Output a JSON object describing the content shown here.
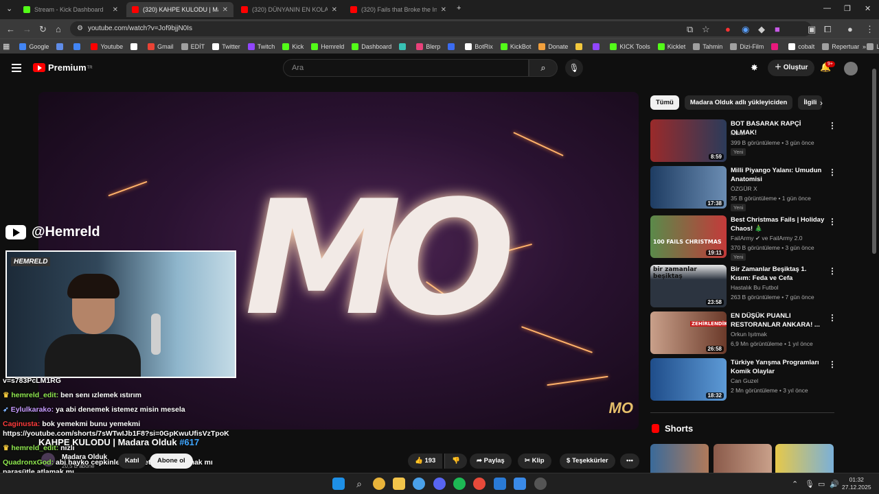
{
  "browser": {
    "tabs": [
      {
        "title": "Stream - Kick Dashboard",
        "color": "#53fc18"
      },
      {
        "title": "(320) KAHPE KULODU | Madara",
        "color": "#ff0000"
      },
      {
        "title": "(320) DÜNYANIN EN KOLAY BA",
        "color": "#ff0000"
      },
      {
        "title": "(320) Fails that Broke the Inter",
        "color": "#ff0000"
      }
    ],
    "url": "youtube.com/watch?v=Jof9bjjN0Is",
    "bookmarks": [
      {
        "label": "Google",
        "color": "#4285f4"
      },
      {
        "label": "",
        "color": "#5f8ce8"
      },
      {
        "label": "",
        "color": "#4285f4"
      },
      {
        "label": "Youtube",
        "color": "#ff0000"
      },
      {
        "label": "",
        "color": "#ffffff"
      },
      {
        "label": "Gmail",
        "color": "#ea4335"
      },
      {
        "label": "EDİT",
        "color": "#a0a0a0"
      },
      {
        "label": "Twitter",
        "color": "#ffffff"
      },
      {
        "label": "Twitch",
        "color": "#9146ff"
      },
      {
        "label": "Kick",
        "color": "#53fc18"
      },
      {
        "label": "Hemreld",
        "color": "#53fc18"
      },
      {
        "label": "Dashboard",
        "color": "#53fc18"
      },
      {
        "label": "",
        "color": "#38c2b5"
      },
      {
        "label": "Blerp",
        "color": "#e8417a"
      },
      {
        "label": "",
        "color": "#3b6cf2"
      },
      {
        "label": "BotRix",
        "color": "#ffffff"
      },
      {
        "label": "KickBot",
        "color": "#53fc18"
      },
      {
        "label": "Donate",
        "color": "#f2a03d"
      },
      {
        "label": "",
        "color": "#f2c83d"
      },
      {
        "label": "",
        "color": "#9146ff"
      },
      {
        "label": "KICK Tools",
        "color": "#53fc18"
      },
      {
        "label": "Kicklet",
        "color": "#53fc18"
      },
      {
        "label": "Tahmin",
        "color": "#a0a0a0"
      },
      {
        "label": "Dizi-Film",
        "color": "#a0a0a0"
      },
      {
        "label": "",
        "color": "#e8197c"
      },
      {
        "label": "cobalt",
        "color": "#ffffff"
      },
      {
        "label": "Repertuar",
        "color": "#a0a0a0"
      },
      {
        "label": "Looper",
        "color": "#a0a0a0"
      }
    ]
  },
  "youtube": {
    "logo_text": "Premium",
    "logo_sup": "TR",
    "search_placeholder": "Ara",
    "create_label": "Oluştur",
    "notif_count": "9+"
  },
  "video": {
    "title": "KAHPE KULODU | Madara Olduk",
    "hashtag": "#617",
    "channel": "Madara Olduk",
    "subs": "20,5 B abone",
    "join_label": "Katıl",
    "subscribe_label": "Abone ol",
    "likes": "193",
    "share_label": "Paylaş",
    "clip_label": "Klip",
    "thanks_label": "Teşekkürler",
    "watermark_small": "MO"
  },
  "overlay": {
    "handle": "@Hemreld",
    "webcam_logo": "HEMRELD",
    "chat": [
      {
        "user": "",
        "text": "v=s783PcLM1RG",
        "color": "#ffffff"
      },
      {
        "user": "hemreld_edit:",
        "text": "ben senı ızlemek ıstırım",
        "color": "#8fe84f"
      },
      {
        "user": "Eylulkarako:",
        "text": "ya abi denemek istemez misin mesela",
        "color": "#c79bff"
      },
      {
        "user": "Caginusta:",
        "text": "bok yemekmi bunu yemekmi https://youtube.com/shorts/7sWTwIJb1F8?si=0GpKwuUfisVzTpoK",
        "color": "#ff3c3c"
      },
      {
        "user": "hemreld_edit:",
        "text": "nızlı",
        "color": "#8fe84f"
      },
      {
        "user": "QuadronxGod:",
        "text": "abi hayko cepkinle 1 yıl metin2 çar kasmak mı paraşütle atlamak mı",
        "color": "#8fe84f"
      }
    ]
  },
  "sidebar": {
    "chips": [
      "Tümü",
      "Madara Olduk adlı yükleyiciden",
      "İlgili"
    ],
    "recommendations": [
      {
        "title": "BOT BASARAK RAPÇİ OLMAK!",
        "channel": "luther",
        "meta": "399 B görüntüleme • 3 gün önce",
        "new": "Yeni",
        "duration": "8:59",
        "thumb_bg": "#3b3b3b"
      },
      {
        "title": "Milli Piyango Yalanı: Umudun Anatomisi",
        "channel": "ÖZGÜR X",
        "meta": "35 B görüntüleme • 1 gün önce",
        "new": "Yeni",
        "duration": "17:38",
        "thumb_bg": "#2a4a6a"
      },
      {
        "title": "Best Christmas Fails | Holiday Chaos! 🎄",
        "channel": "FailArmy ✔ ve FailArmy 2.0",
        "meta": "370 B görüntüleme • 3 gün önce",
        "new": "Yeni",
        "duration": "19:11",
        "thumb_bg": "#3f7a43"
      },
      {
        "title": "Bir Zamanlar Beşiktaş 1. Kısım: Feda ve Cefa",
        "channel": "Hastalık Bu Futbol",
        "meta": "263 B görüntüleme • 7 gün önce",
        "new": "",
        "duration": "23:58",
        "thumb_bg": "#2c3440"
      },
      {
        "title": "EN DÜŞÜK PUANLI RESTORANLAR ANKARA! ...",
        "channel": "Orkun Işıtmak",
        "meta": "6,9 Mn görüntüleme • 1 yıl önce",
        "new": "",
        "duration": "26:58",
        "thumb_bg": "#6b3a2a"
      },
      {
        "title": "Türkiye Yarışma Programları Komik Olaylar",
        "channel": "Can Guzel",
        "meta": "2 Mn görüntüleme • 3 yıl önce",
        "new": "",
        "duration": "18:32",
        "thumb_bg": "#27527f"
      }
    ],
    "thumb_texts": [
      "100 FAILS CHRISTMAS",
      "bir zamanlar beşiktaş",
      "ZEHİRLENDİK!"
    ],
    "shorts_label": "Shorts"
  },
  "taskbar": {
    "time": "01:32",
    "date": "27.12.2025"
  }
}
